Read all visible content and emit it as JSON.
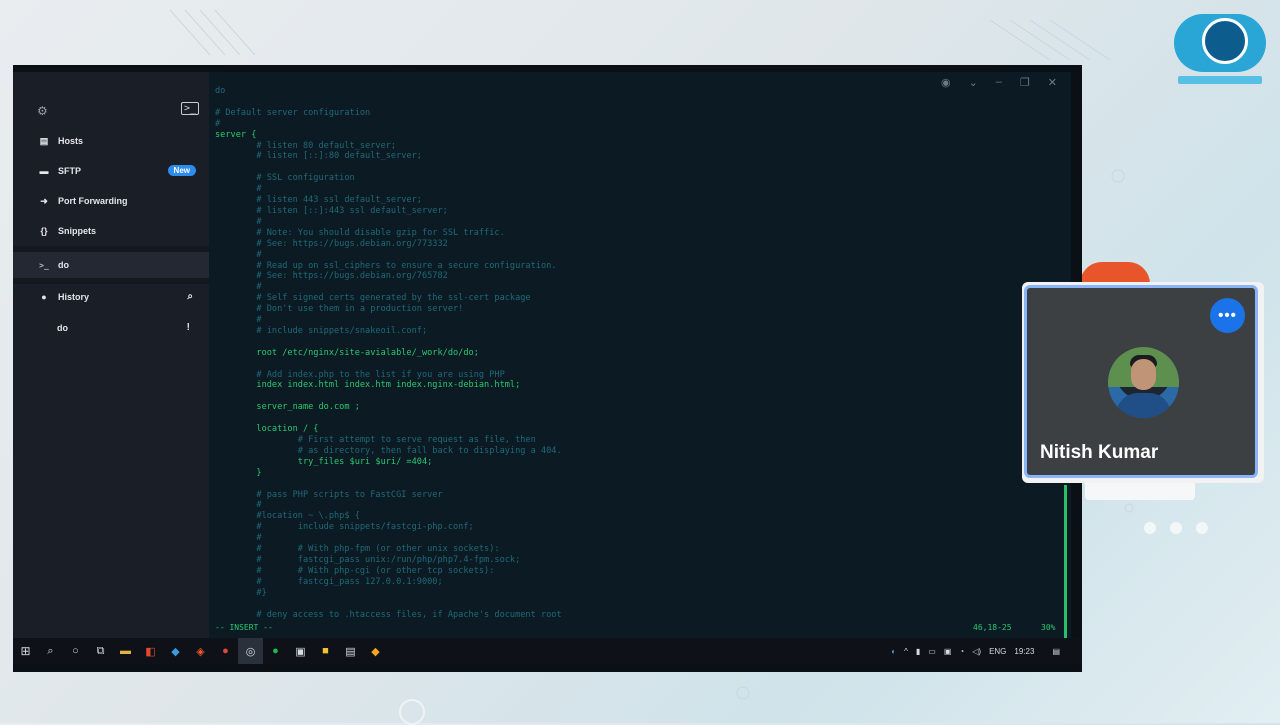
{
  "sidebar": {
    "items": [
      {
        "label": "Hosts",
        "icon": "hosts-icon"
      },
      {
        "label": "SFTP",
        "icon": "folder-icon",
        "badge": "New"
      },
      {
        "label": "Port Forwarding",
        "icon": "port-forward-icon"
      },
      {
        "label": "Snippets",
        "icon": "snippets-icon"
      }
    ],
    "active_session": {
      "label": "do",
      "icon": "terminal-prompt-icon"
    },
    "history": {
      "label": "History",
      "entries": [
        {
          "label": "do",
          "flag": "!"
        }
      ]
    }
  },
  "terminal": {
    "lines": [
      {
        "t": "c",
        "text": "do"
      },
      {
        "t": "c",
        "text": ""
      },
      {
        "t": "c",
        "text": "# Default server configuration"
      },
      {
        "t": "c",
        "text": "#"
      },
      {
        "t": "k",
        "text": "server {"
      },
      {
        "t": "c",
        "text": "        # listen 80 default_server;"
      },
      {
        "t": "c",
        "text": "        # listen [::]:80 default_server;"
      },
      {
        "t": "c",
        "text": ""
      },
      {
        "t": "c",
        "text": "        # SSL configuration"
      },
      {
        "t": "c",
        "text": "        #"
      },
      {
        "t": "c",
        "text": "        # listen 443 ssl default_server;"
      },
      {
        "t": "c",
        "text": "        # listen [::]:443 ssl default_server;"
      },
      {
        "t": "c",
        "text": "        #"
      },
      {
        "t": "c",
        "text": "        # Note: You should disable gzip for SSL traffic."
      },
      {
        "t": "c",
        "text": "        # See: https://bugs.debian.org/773332"
      },
      {
        "t": "c",
        "text": "        #"
      },
      {
        "t": "c",
        "text": "        # Read up on ssl_ciphers to ensure a secure configuration."
      },
      {
        "t": "c",
        "text": "        # See: https://bugs.debian.org/765782"
      },
      {
        "t": "c",
        "text": "        #"
      },
      {
        "t": "c",
        "text": "        # Self signed certs generated by the ssl-cert package"
      },
      {
        "t": "c",
        "text": "        # Don't use them in a production server!"
      },
      {
        "t": "c",
        "text": "        #"
      },
      {
        "t": "c",
        "text": "        # include snippets/snakeoil.conf;"
      },
      {
        "t": "c",
        "text": ""
      },
      {
        "t": "k",
        "text": "        root /etc/nginx/site-avialable/_work/do/do;"
      },
      {
        "t": "c",
        "text": ""
      },
      {
        "t": "c",
        "text": "        # Add index.php to the list if you are using PHP"
      },
      {
        "t": "k",
        "text": "        index index.html index.htm index.nginx-debian.html;"
      },
      {
        "t": "c",
        "text": ""
      },
      {
        "t": "k",
        "text": "        server_name do.com ;"
      },
      {
        "t": "c",
        "text": ""
      },
      {
        "t": "k",
        "text": "        location / {"
      },
      {
        "t": "c",
        "text": "                # First attempt to serve request as file, then"
      },
      {
        "t": "c",
        "text": "                # as directory, then fall back to displaying a 404."
      },
      {
        "t": "k",
        "text": "                try_files $uri $uri/ =404;"
      },
      {
        "t": "k",
        "text": "        }"
      },
      {
        "t": "c",
        "text": ""
      },
      {
        "t": "c",
        "text": "        # pass PHP scripts to FastCGI server"
      },
      {
        "t": "c",
        "text": "        #"
      },
      {
        "t": "c",
        "text": "        #location ~ \\.php$ {"
      },
      {
        "t": "c",
        "text": "        #       include snippets/fastcgi-php.conf;"
      },
      {
        "t": "c",
        "text": "        #"
      },
      {
        "t": "c",
        "text": "        #       # With php-fpm (or other unix sockets):"
      },
      {
        "t": "c",
        "text": "        #       fastcgi_pass unix:/run/php/php7.4-fpm.sock;"
      },
      {
        "t": "c",
        "text": "        #       # With php-cgi (or other tcp sockets):"
      },
      {
        "t": "c",
        "text": "        #       fastcgi_pass 127.0.0.1:9000;"
      },
      {
        "t": "c",
        "text": "        #}"
      },
      {
        "t": "c",
        "text": ""
      },
      {
        "t": "c",
        "text": "        # deny access to .htaccess files, if Apache's document root"
      }
    ],
    "status_mode": "-- INSERT --",
    "cursor_position": "46,18-25",
    "scroll_percent": "30%"
  },
  "taskbar": {
    "language": "ENG",
    "time": "19:23"
  },
  "participant": {
    "name": "Nitish Kumar",
    "more_label": "•••"
  },
  "colors": {
    "accent_blue": "#1a73e8",
    "tile_border": "#8ab4f8",
    "terminal_green": "#2bc96f",
    "badge_blue": "#2d8cf0"
  }
}
